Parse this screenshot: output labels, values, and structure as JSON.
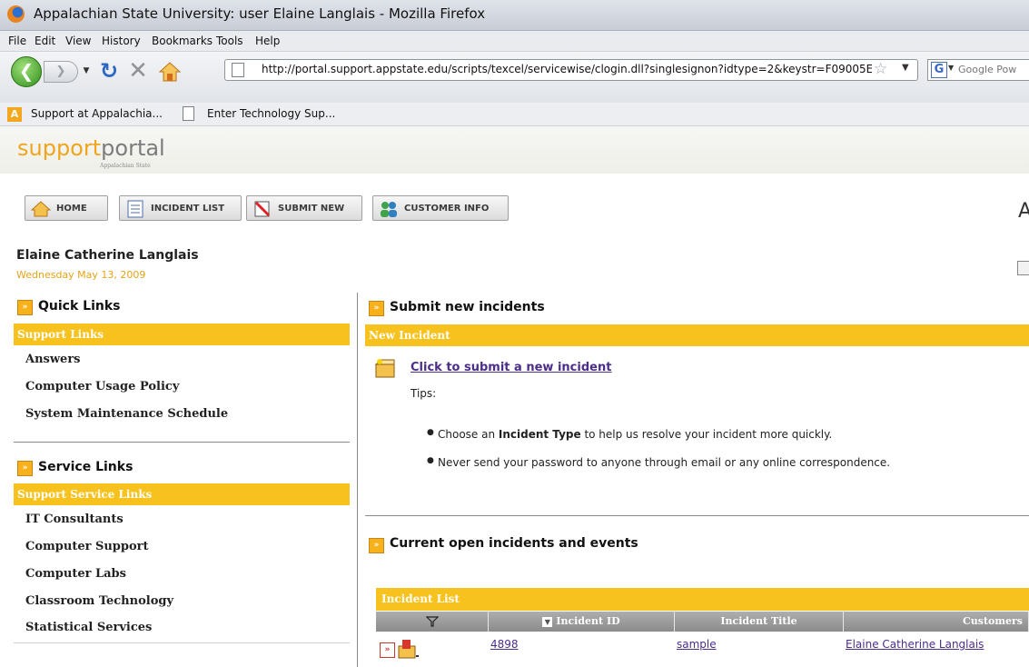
{
  "window": {
    "title": "Appalachian State University: user Elaine Langlais - Mozilla Firefox"
  },
  "menu": [
    "File",
    "Edit",
    "View",
    "History",
    "Bookmarks",
    "Tools",
    "Help"
  ],
  "nav": {
    "url": "http://portal.support.appstate.edu/scripts/texcel/servicewise/clogin.dll?singlesignon?idtype=2&keystr=F09005E",
    "search_placeholder": "Google Pow",
    "icons": [
      "back-icon",
      "forward-icon",
      "reload-icon",
      "stop-icon",
      "home-icon",
      "page-icon",
      "bookmark-star-icon",
      "google-icon"
    ]
  },
  "bookmarks": [
    "Support at Appalachia...",
    "Enter Technology Sup..."
  ],
  "portal": {
    "logo_support": "support",
    "logo_portal": "portal",
    "logo_sub": "Appalachian State",
    "buttons": [
      "HOME",
      "INCIDENT LIST",
      "SUBMIT NEW",
      "CUSTOMER INFO"
    ],
    "right_cut": "A"
  },
  "user": {
    "name": "Elaine Catherine Langlais",
    "date": "Wednesday May 13, 2009"
  },
  "quick_links": {
    "title": "Quick Links",
    "bar": "Support Links",
    "items": [
      "Answers",
      "Computer Usage Policy",
      "System Maintenance Schedule"
    ]
  },
  "service_links": {
    "title": "Service Links",
    "bar": "Support Service Links",
    "items": [
      "IT Consultants",
      "Computer Support",
      "Computer Labs",
      "Classroom Technology",
      "Statistical Services"
    ]
  },
  "submit": {
    "title": "Submit new incidents",
    "bar": "New Incident",
    "link": "Click to submit a new incident",
    "tips": "Tips:",
    "tip1_pre": "Choose an ",
    "tip1_bold": "Incident Type",
    "tip1_post": " to help us resolve your incident more quickly.",
    "tip2": "Never send your password to anyone through email or any online correspondence."
  },
  "incidents": {
    "title": "Current open incidents and events",
    "bar": "Incident List",
    "columns": [
      "",
      "Incident ID",
      "Incident Title",
      "Customers"
    ],
    "rows": [
      {
        "id": "4898",
        "title": "sample",
        "customer": "Elaine Catherine Langlais"
      }
    ]
  },
  "colors": {
    "accent": "#f7c21d",
    "logo_orange": "#f0a51c",
    "link": "#4b2d8a"
  }
}
